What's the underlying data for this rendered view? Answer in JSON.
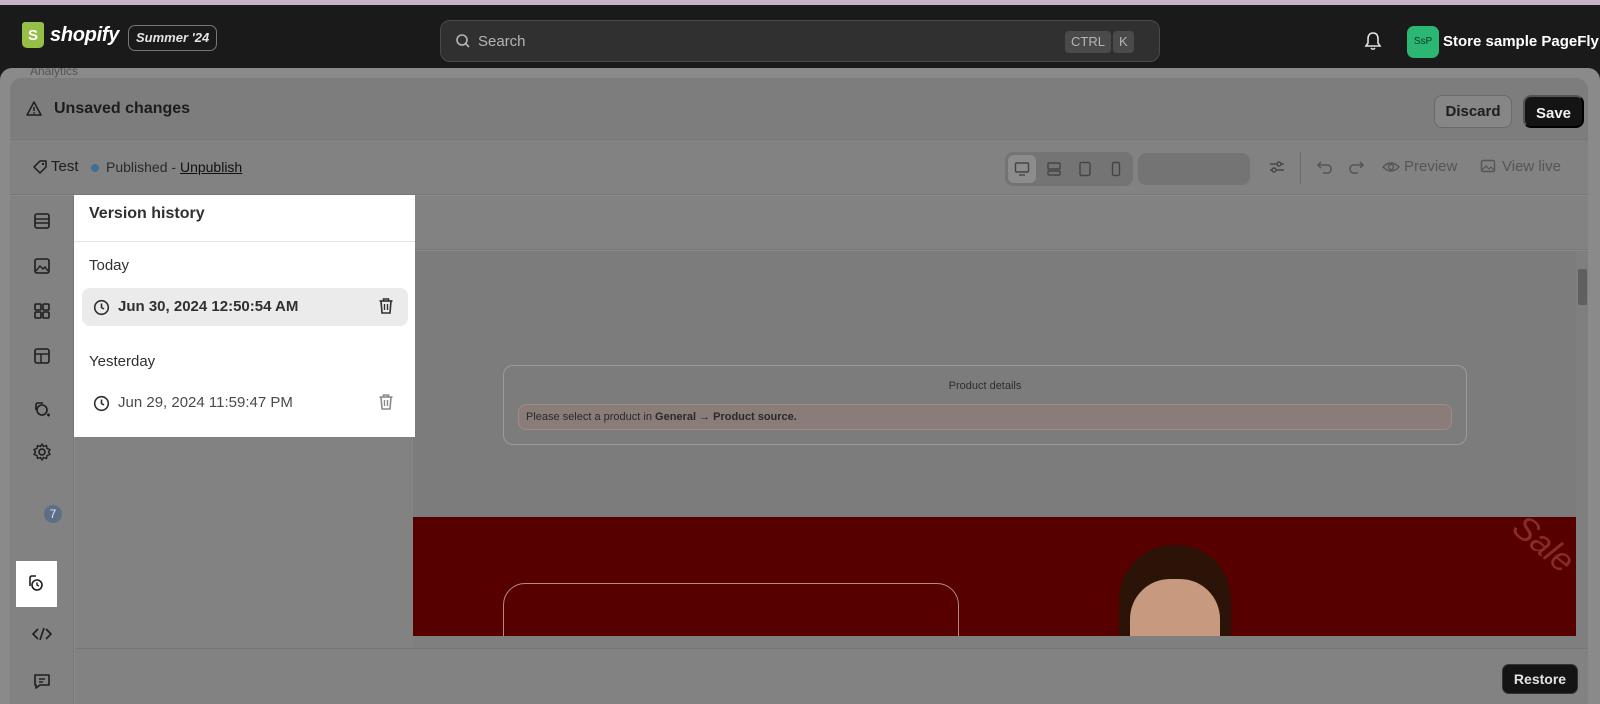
{
  "topbar": {
    "logo_text": "shopify",
    "edition_badge": "Summer '24",
    "search_placeholder": "Search",
    "kbd_ctrl": "CTRL",
    "kbd_k": "K",
    "avatar_initials": "SsP",
    "store_name": "Store sample PageFly"
  },
  "breadcrumb": "Analytics",
  "unsaved_bar": {
    "title": "Unsaved changes",
    "discard_label": "Discard",
    "save_label": "Save"
  },
  "editor_toolbar": {
    "page_name": "Test",
    "status": "Published",
    "separator": "-",
    "unpublish_label": "Unpublish",
    "preview_label": "Preview",
    "view_live_label": "View live"
  },
  "left_rail": {
    "badge_count": "7"
  },
  "version_history": {
    "title": "Version history",
    "groups": [
      {
        "label": "Today",
        "versions": [
          {
            "time": "Jun 30, 2024 12:50:54 AM",
            "selected": true
          }
        ]
      },
      {
        "label": "Yesterday",
        "versions": [
          {
            "time": "Jun 29, 2024 11:59:47 PM",
            "selected": false
          }
        ]
      }
    ]
  },
  "canvas": {
    "product_details_title": "Product details",
    "alert_prefix": "Please select a product in ",
    "alert_strong": "General → Product source.",
    "hero_text": "Sale"
  },
  "bottom_bar": {
    "restore_label": "Restore"
  },
  "colors": {
    "overlay_gray": "#828282",
    "save_button": "#141414",
    "avatar_green": "#2bb673",
    "hero_red": "#560000"
  }
}
